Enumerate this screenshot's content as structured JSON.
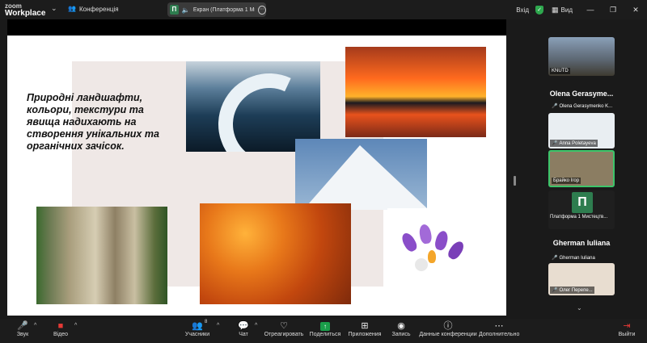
{
  "app": {
    "logo_line1": "zoom",
    "logo_line2": "Workplace"
  },
  "topbar": {
    "meeting_name": "Конференція",
    "screen_share_badge": "П",
    "screen_share_label": "Екран (Платформа 1 Мистецтво...",
    "signin_label": "Вхід",
    "view_label": "Вид"
  },
  "slide": {
    "text": "Природні ландшафти, кольори, текстури та явища надихають на створення унікальних та органічних зачісок."
  },
  "gallery": {
    "tiles": [
      {
        "label": "KNUTD"
      },
      {
        "big_name": "Olena Gerasyme...",
        "label": "Olena Gerasymenko K..."
      },
      {
        "label": "Anna Poletayeva"
      },
      {
        "label": "Брайко Ігор"
      },
      {
        "badge": "П",
        "label": "Платформа 1 Мистецтв..."
      },
      {
        "big_name": "Gherman Iuliana",
        "label": "Gherman Iuliana"
      },
      {
        "label": "Олег Перепе..."
      }
    ]
  },
  "toolbar": {
    "audio": "Звук",
    "video": "Відео",
    "participants": "Учасники",
    "participants_count": "8",
    "chat": "Чат",
    "react": "Отреагировать",
    "share": "Поделиться",
    "apps": "Приложения",
    "record": "Запись",
    "meeting_data": "Данные конференции",
    "more": "Дополнительно",
    "leave": "Выйти"
  },
  "colors": {
    "accent_green": "#1a9e4a",
    "active_speaker_border": "#3cc56a",
    "muted_red": "#e53935"
  }
}
